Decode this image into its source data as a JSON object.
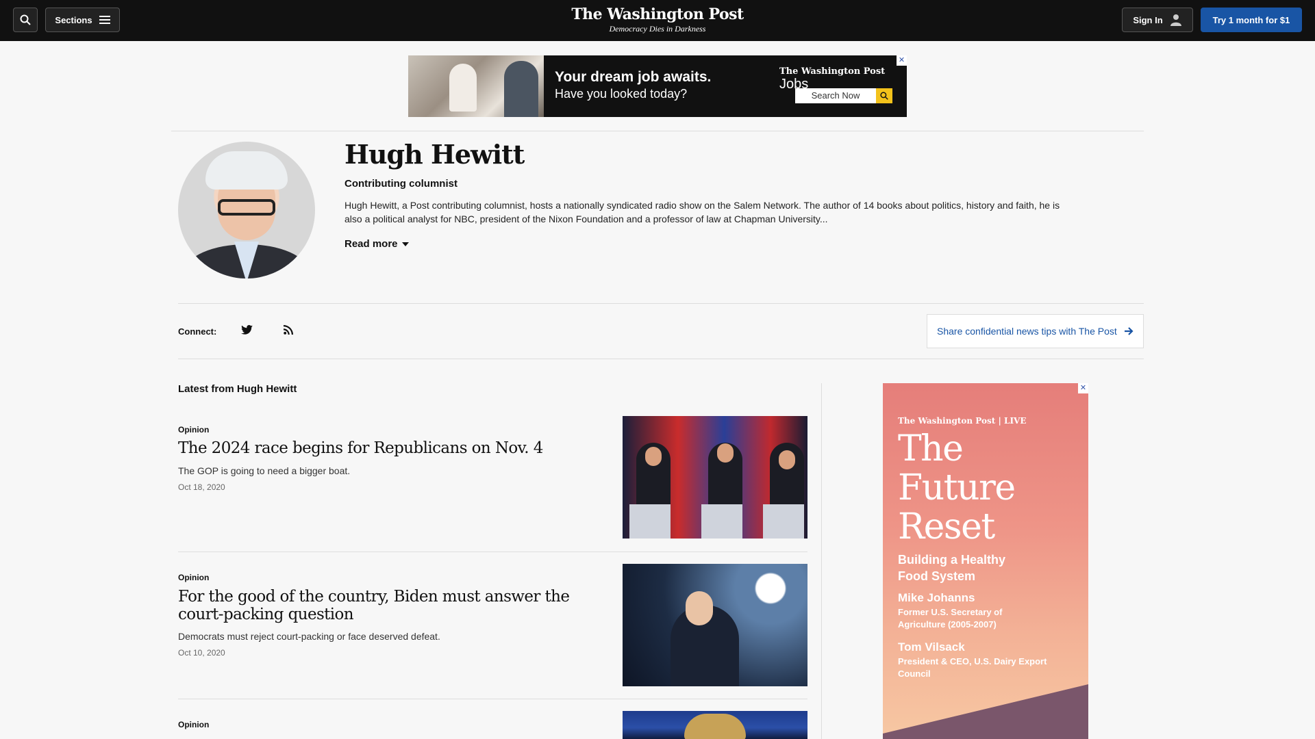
{
  "header": {
    "sections_label": "Sections",
    "logo_text": "The Washington Post",
    "tagline": "Democracy Dies in Darkness",
    "signin_label": "Sign In",
    "subscribe_label": "Try 1 month for $1"
  },
  "top_ad": {
    "headline": "Your dream job awaits.",
    "subline": "Have you looked today?",
    "brand": "The Washington Post",
    "brand_suffix": "Jobs",
    "search_label": "Search Now"
  },
  "author": {
    "name": "Hugh Hewitt",
    "role": "Contributing columnist",
    "bio": "Hugh Hewitt, a Post contributing columnist, hosts a nationally syndicated radio show on the Salem Network. The author of 14 books about politics, history and faith, he is also a political analyst for NBC, president of the Nixon Foundation and a professor of law at Chapman University...",
    "read_more": "Read more"
  },
  "connect": {
    "label": "Connect:",
    "tips_label": "Share confidential news tips with The Post"
  },
  "feed": {
    "heading": "Latest from Hugh Hewitt",
    "articles": [
      {
        "kicker": "Opinion",
        "headline": "The 2024 race begins for Republicans on Nov. 4",
        "dek": "The GOP is going to need a bigger boat.",
        "date": "Oct 18, 2020"
      },
      {
        "kicker": "Opinion",
        "headline": "For the good of the country, Biden must answer the court-packing question",
        "dek": "Democrats must reject court-packing or face deserved defeat.",
        "date": "Oct 10, 2020"
      },
      {
        "kicker": "Opinion"
      }
    ]
  },
  "side_ad": {
    "brand": "The Washington Post | LIVE",
    "title": "The Future Reset",
    "subtitle": "Building a Healthy Food System",
    "speaker1_name": "Mike Johanns",
    "speaker1_role": "Former U.S. Secretary of Agriculture (2005-2007)",
    "speaker2_name": "Tom Vilsack",
    "speaker2_role": "President & CEO, U.S. Dairy Export Council"
  },
  "icons": [
    "search-icon",
    "menu-icon",
    "user-icon",
    "twitter-icon",
    "rss-icon",
    "arrow-right-icon",
    "chevron-down-icon",
    "ad-close-icon"
  ]
}
